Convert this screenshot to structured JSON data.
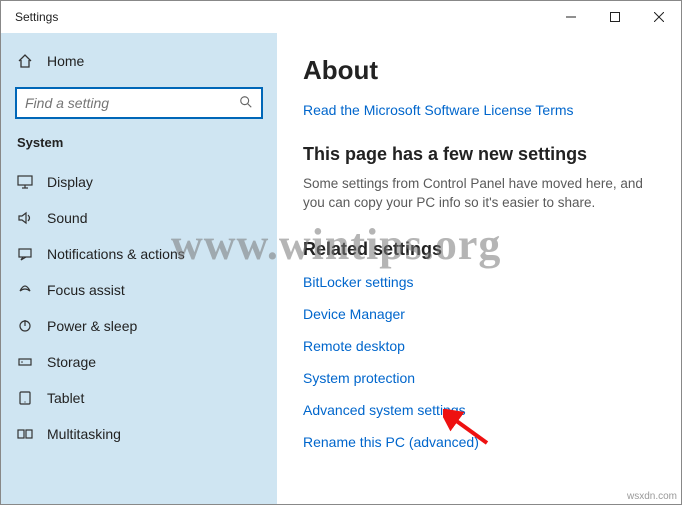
{
  "window": {
    "title": "Settings"
  },
  "sidebar": {
    "home_label": "Home",
    "search_placeholder": "Find a setting",
    "section_label": "System",
    "items": [
      {
        "label": "Display"
      },
      {
        "label": "Sound"
      },
      {
        "label": "Notifications & actions"
      },
      {
        "label": "Focus assist"
      },
      {
        "label": "Power & sleep"
      },
      {
        "label": "Storage"
      },
      {
        "label": "Tablet"
      },
      {
        "label": "Multitasking"
      }
    ]
  },
  "main": {
    "title": "About",
    "license_link": "Read the Microsoft Software License Terms",
    "new_settings_head": "This page has a few new settings",
    "new_settings_body": "Some settings from Control Panel have moved here, and you can copy your PC info so it's easier to share.",
    "related_head": "Related settings",
    "related_links": [
      "BitLocker settings",
      "Device Manager",
      "Remote desktop",
      "System protection",
      "Advanced system settings",
      "Rename this PC (advanced)"
    ]
  },
  "watermark": "www.wintips.org",
  "credit": "wsxdn.com"
}
